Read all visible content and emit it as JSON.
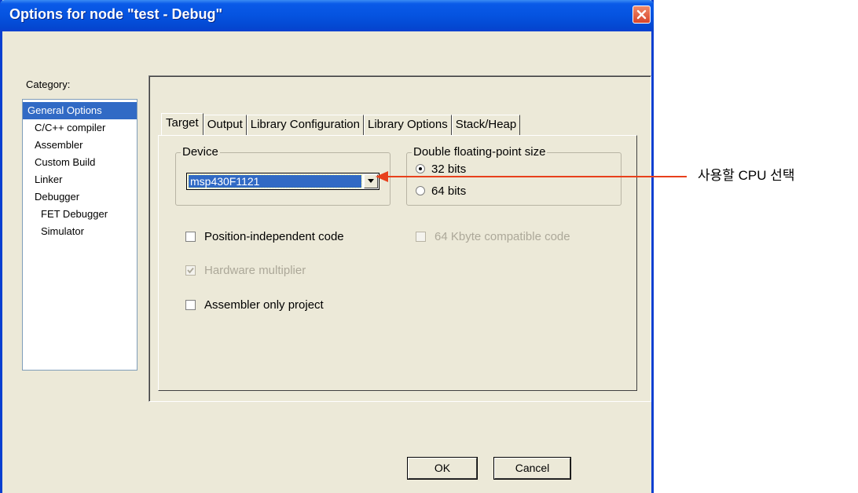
{
  "window": {
    "title": "Options for node \"test - Debug\""
  },
  "category": {
    "label": "Category:",
    "items": [
      {
        "label": "General Options",
        "level": 0,
        "selected": true
      },
      {
        "label": "C/C++ compiler",
        "level": 1
      },
      {
        "label": "Assembler",
        "level": 1
      },
      {
        "label": "Custom Build",
        "level": 1
      },
      {
        "label": "Linker",
        "level": 1
      },
      {
        "label": "Debugger",
        "level": 1
      },
      {
        "label": "FET Debugger",
        "level": 2
      },
      {
        "label": "Simulator",
        "level": 2
      }
    ]
  },
  "tabs": [
    {
      "label": "Target",
      "active": true
    },
    {
      "label": "Output"
    },
    {
      "label": "Library Configuration"
    },
    {
      "label": "Library Options"
    },
    {
      "label": "Stack/Heap"
    }
  ],
  "device": {
    "group_label": "Device",
    "selected": "msp430F1121"
  },
  "float_size": {
    "group_label": "Double floating-point size",
    "option_32": "32 bits",
    "option_64": "64 bits",
    "selected": "32 bits"
  },
  "options": {
    "position_independent": {
      "label": "Position-independent code",
      "checked": false,
      "enabled": true
    },
    "kbyte_compat": {
      "label": "64 Kbyte compatible code",
      "checked": false,
      "enabled": false
    },
    "hw_multiplier": {
      "label": "Hardware multiplier",
      "checked": true,
      "enabled": false
    },
    "asm_only": {
      "label": "Assembler only project",
      "checked": false,
      "enabled": true
    }
  },
  "buttons": {
    "ok": "OK",
    "cancel": "Cancel"
  },
  "annotation": {
    "text": "사용할 CPU 선택",
    "color": "#e8401c"
  }
}
